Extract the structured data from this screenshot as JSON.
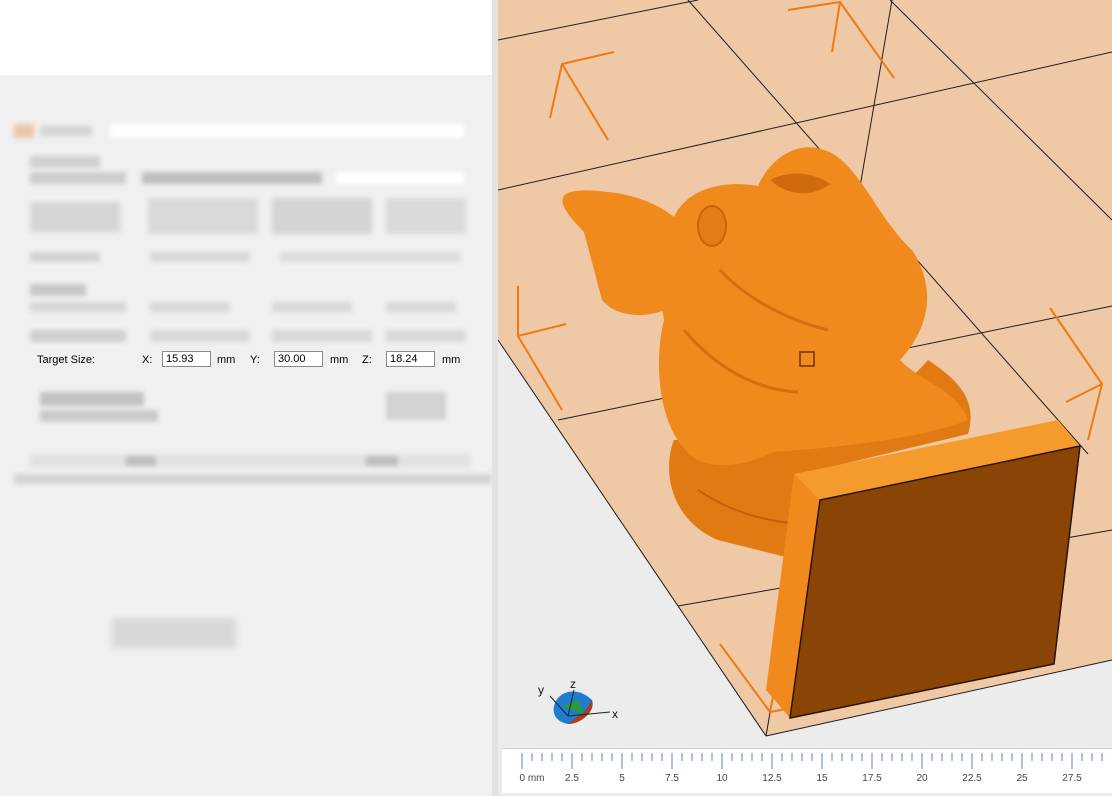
{
  "target_size": {
    "label": "Target Size:",
    "x_label": "X:",
    "x_value": "15.93",
    "y_label": "Y:",
    "y_value": "30.00",
    "z_label": "Z:",
    "z_value": "18.24",
    "unit": "mm"
  },
  "axes": {
    "x": "x",
    "y": "y",
    "z": "z"
  },
  "ruler": {
    "labels": [
      "0 mm",
      "2.5",
      "5",
      "7.5",
      "10",
      "12.5",
      "15",
      "17.5",
      "20",
      "22.5",
      "25",
      "27.5"
    ]
  },
  "colors": {
    "model": "#f08a1c",
    "base_face": "#8a4406",
    "bed": "#efc8a6",
    "bed_lines": "#1e1e1e"
  }
}
